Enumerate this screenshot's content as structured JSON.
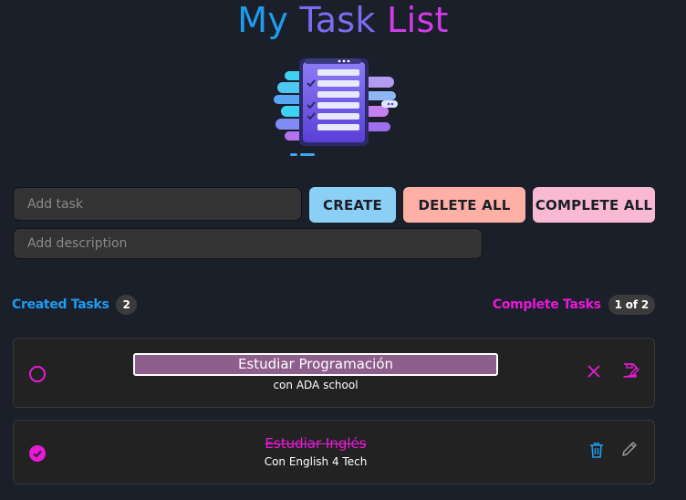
{
  "header": {
    "title_part1": "My",
    "title_part2": "Task",
    "title_part3": "List"
  },
  "form": {
    "task_placeholder": "Add task",
    "description_placeholder": "Add description",
    "create_label": "CREATE",
    "delete_all_label": "DELETE ALL",
    "complete_all_label": "COMPLETE ALL"
  },
  "summary": {
    "created_label": "Created Tasks",
    "created_count": "2",
    "complete_label": "Complete Tasks",
    "complete_count": "1 of 2"
  },
  "tasks": [
    {
      "title": "Estudiar Programación",
      "description": "con ADA school",
      "completed": false,
      "editing": true
    },
    {
      "title": "Estudiar Inglés",
      "description": "Con English 4 Tech",
      "completed": true,
      "editing": false
    }
  ],
  "colors": {
    "background": "#1b1f2a",
    "create": "#8ccff5",
    "delete_all": "#ffb0a6",
    "complete_all": "#f9b9d2",
    "accent_blue": "#1f9cf0",
    "accent_magenta": "#e81ad7",
    "editing_bg": "#8e5e8c"
  }
}
